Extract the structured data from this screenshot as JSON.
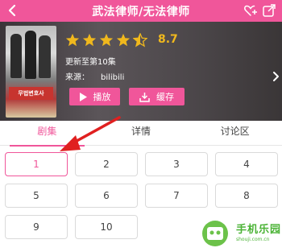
{
  "header": {
    "title": "武法律师/无法律师",
    "back_icon": "chevron-left-icon",
    "favorite_icon": "heart-add-icon",
    "share_icon": "share-icon"
  },
  "info": {
    "rating": "8.7",
    "star_rating": 4.5,
    "update_text": "更新至第10集",
    "source_label": "来源：",
    "source_value": "bilibili",
    "poster_text": "무법변호사"
  },
  "buttons": {
    "play": "播放",
    "cache": "缓存"
  },
  "tabs": [
    "剧集",
    "详情",
    "讨论区"
  ],
  "episodes": [
    "1",
    "2",
    "3",
    "4",
    "5",
    "6",
    "7",
    "8",
    "9",
    "10"
  ],
  "selected_episode": "1",
  "watermark": {
    "text": "手机乐园",
    "url": "shouji.com.cn"
  },
  "colors": {
    "accent": "#f0569a",
    "star": "#f0b81d",
    "arrow": "#e02020",
    "watermark": "#4bb336"
  }
}
